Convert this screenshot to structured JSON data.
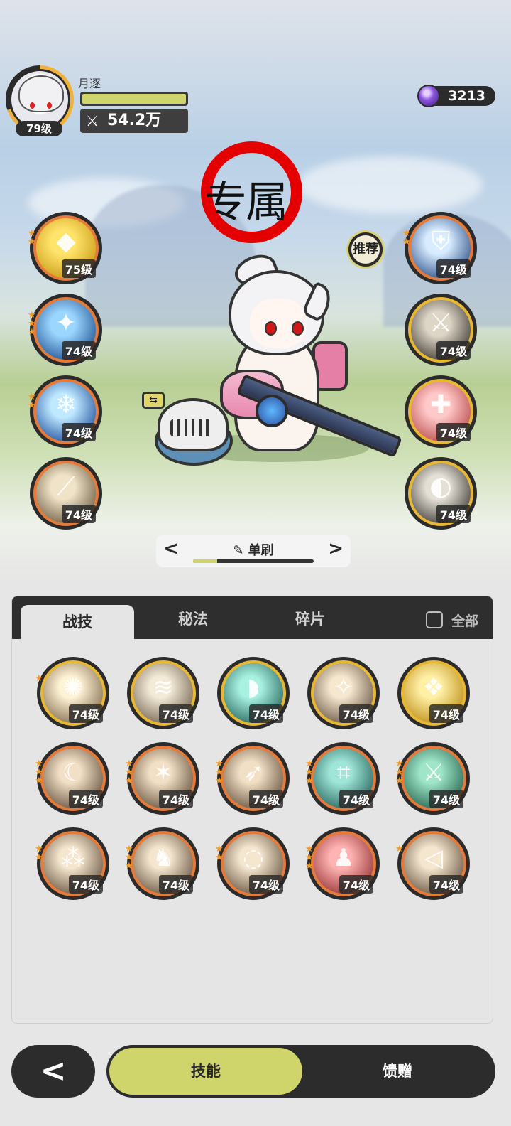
{
  "player": {
    "name": "月逐",
    "level": "79级",
    "power": "54.2万",
    "hp_fraction": 1.0
  },
  "currency": {
    "icon": "purple-gem-icon",
    "amount": "3213"
  },
  "marker": {
    "text": "专属",
    "color": "#e40000"
  },
  "recommend_label": "推荐",
  "left_equipment": [
    {
      "name": "golden-crystal",
      "level": "75级",
      "stars": 2
    },
    {
      "name": "blue-cloud-dome",
      "level": "74级",
      "stars": 3
    },
    {
      "name": "ice-shard",
      "level": "74级",
      "stars": 2
    },
    {
      "name": "light-slash",
      "level": "74级",
      "stars": 0
    }
  ],
  "right_equipment": [
    {
      "name": "blue-shield",
      "level": "74级",
      "stars": 2
    },
    {
      "name": "dark-blade",
      "level": "74级",
      "stars": 0
    },
    {
      "name": "red-sword",
      "level": "74级",
      "stars": 0
    },
    {
      "name": "shadow-swirl",
      "level": "74级",
      "stars": 0
    }
  ],
  "mode": {
    "label": "单刷",
    "prev_icon": "chevron-left-icon",
    "next_icon": "chevron-right-icon",
    "progress": 0.2
  },
  "tabs": {
    "combat": "战技",
    "arcane": "秘法",
    "fragments": "碎片",
    "all": "全部"
  },
  "skills": [
    {
      "name": "burst",
      "level": "74级",
      "stars": 1
    },
    {
      "name": "wind-slash",
      "level": "74级",
      "stars": 0
    },
    {
      "name": "teal-wave",
      "level": "74级",
      "stars": 0
    },
    {
      "name": "impact",
      "level": "74级",
      "stars": 0
    },
    {
      "name": "golden-rune",
      "level": "74级",
      "stars": 0
    },
    {
      "name": "crescent",
      "level": "74级",
      "stars": 3
    },
    {
      "name": "star-spin",
      "level": "74级",
      "stars": 3
    },
    {
      "name": "dash-strike",
      "level": "74级",
      "stars": 3
    },
    {
      "name": "web-net",
      "level": "74级",
      "stars": 3
    },
    {
      "name": "green-blade",
      "level": "74级",
      "stars": 3
    },
    {
      "name": "triple-mark",
      "level": "74级",
      "stars": 2
    },
    {
      "name": "beast-rush",
      "level": "74级",
      "stars": 3
    },
    {
      "name": "vortex",
      "level": "74级",
      "stars": 2
    },
    {
      "name": "red-figure",
      "level": "74级",
      "stars": 3
    },
    {
      "name": "gale-horn",
      "level": "74级",
      "stars": 1
    }
  ],
  "bottom_nav": {
    "back_icon": "chevron-left-icon",
    "skills": "技能",
    "gift": "馈赠"
  }
}
